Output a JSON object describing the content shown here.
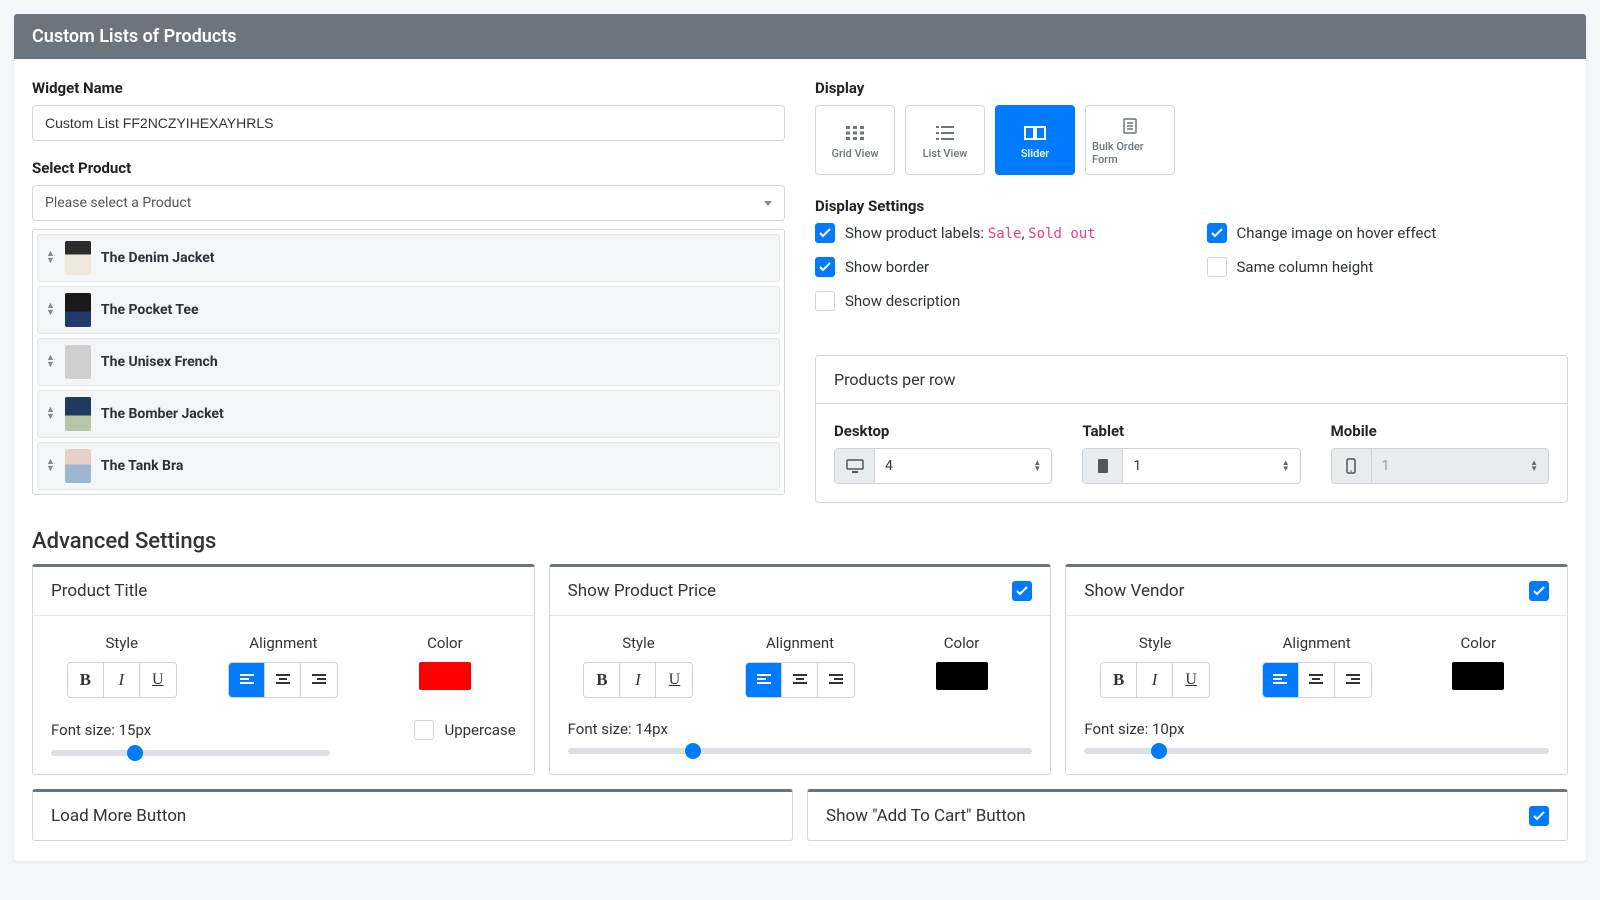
{
  "header": {
    "title": "Custom Lists of Products"
  },
  "left": {
    "widget_name_label": "Widget Name",
    "widget_name_value": "Custom List FF2NCZYIHEXAYHRLS",
    "select_product_label": "Select Product",
    "select_product_placeholder": "Please select a Product",
    "products": [
      {
        "name": "The Denim Jacket"
      },
      {
        "name": "The Pocket Tee"
      },
      {
        "name": "The Unisex French"
      },
      {
        "name": "The Bomber Jacket"
      },
      {
        "name": "The Tank Bra"
      }
    ]
  },
  "display": {
    "label": "Display",
    "options": {
      "grid": "Grid View",
      "list": "List View",
      "slider": "Slider",
      "bulk": "Bulk Order Form"
    },
    "settings_label": "Display Settings",
    "show_labels_prefix": "Show product labels: ",
    "label_sale": "Sale",
    "label_soldout": "Sold out",
    "show_border": "Show border",
    "show_description": "Show description",
    "change_hover": "Change image on hover effect",
    "same_height": "Same column height"
  },
  "ppr": {
    "title": "Products per row",
    "desktop_label": "Desktop",
    "tablet_label": "Tablet",
    "mobile_label": "Mobile",
    "desktop_value": "4",
    "tablet_value": "1",
    "mobile_value": "1"
  },
  "advanced": {
    "title": "Advanced Settings",
    "product_title": {
      "title": "Product Title",
      "style": "Style",
      "alignment": "Alignment",
      "color_label": "Color",
      "color": "#ff0000",
      "font_size_label": "Font size: 15px",
      "uppercase": "Uppercase"
    },
    "price": {
      "title": "Show Product Price",
      "style": "Style",
      "alignment": "Alignment",
      "color_label": "Color",
      "color": "#000000",
      "font_size_label": "Font size: 14px"
    },
    "vendor": {
      "title": "Show Vendor",
      "style": "Style",
      "alignment": "Alignment",
      "color_label": "Color",
      "color": "#000000",
      "font_size_label": "Font size: 10px"
    },
    "load_more": {
      "title": "Load More Button"
    },
    "add_to_cart": {
      "title": "Show \"Add To Cart\" Button"
    }
  }
}
